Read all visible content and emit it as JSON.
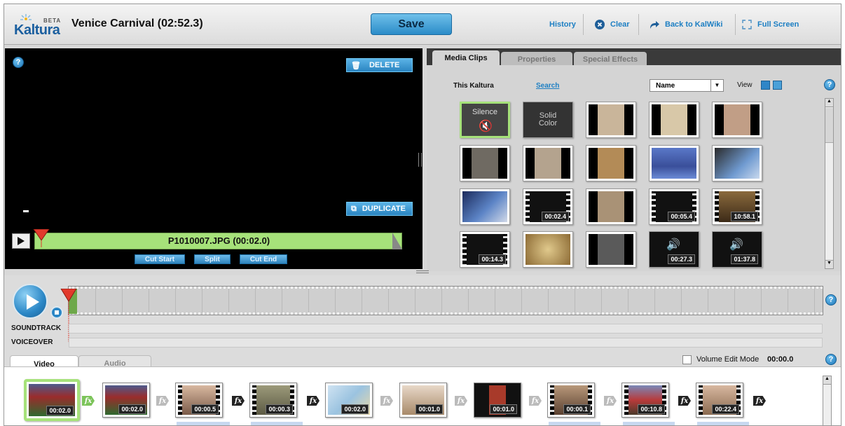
{
  "app": {
    "brand": "Kaltura",
    "beta": "BETA",
    "title": "Venice Carnival  (02:52.3)"
  },
  "header": {
    "save": "Save",
    "history": "History",
    "clear": "Clear",
    "back": "Back to KalWiki",
    "fullscreen": "Full Screen"
  },
  "player": {
    "delete": "DELETE",
    "duplicate": "DUPLICATE",
    "clip_label": "P1010007.JPG (00:02.0)",
    "cut_start": "Cut Start",
    "split": "Split",
    "cut_end": "Cut End"
  },
  "media": {
    "tabs": [
      "Media Clips",
      "Properties",
      "Special Effects"
    ],
    "source": "This Kaltura",
    "search": "Search",
    "sort_value": "Name",
    "view_label": "View",
    "silence": "Silence",
    "solid_color_1": "Solid",
    "solid_color_2": "Color",
    "durations": [
      "00:02.4",
      "00:05.4",
      "10:58.1",
      "00:14.3",
      "00:27.3",
      "01:37.8"
    ]
  },
  "timeline": {
    "soundtrack": "SOUNDTRACK",
    "voiceover": "VOICEOVER"
  },
  "bottom": {
    "tabs": [
      "Video",
      "Audio"
    ],
    "volume_edit_mode": "Volume Edit Mode",
    "time": "00:00.0",
    "clip_durations": [
      "00:02.0",
      "00:02.0",
      "00:00.5",
      "00:00.3",
      "00:02.0",
      "00:01.0",
      "00:01.0",
      "00:00.1",
      "00:10.8",
      "00:22.4"
    ],
    "fx": "fx"
  },
  "colors": {
    "accent": "#2b8cc8",
    "link": "#1d7fc3",
    "scrub": "#a6e27a",
    "selected": "#a6e27a"
  }
}
